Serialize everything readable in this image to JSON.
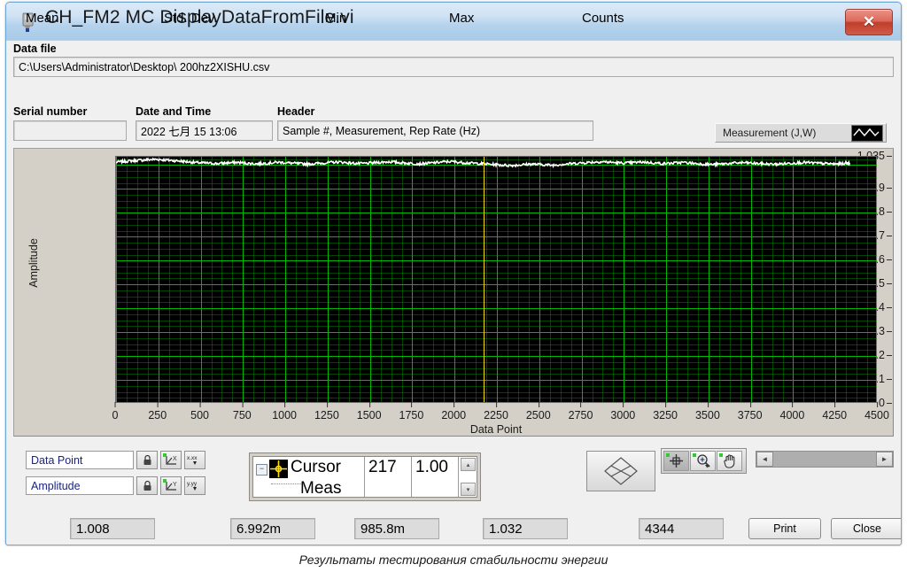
{
  "window": {
    "title": "CH_FM2 MC DisplayDataFromFile.vi",
    "icon": "labview-vi-icon",
    "close_label": "✕",
    "close_icon": "close-icon"
  },
  "datafile": {
    "label": "Data file",
    "value": "C:\\Users\\Administrator\\Desktop\\ 200hz2XISHU.csv"
  },
  "fields": {
    "serial_label": "Serial number",
    "serial_value": "",
    "datetime_label": "Date and Time",
    "datetime_value": "2022 七月 15 13:06",
    "header_label": "Header",
    "header_value": "Sample #, Measurement, Rep Rate (Hz)"
  },
  "legend": {
    "plot_name": "Measurement (J,W)",
    "swatch_icon": "waveform-icon",
    "trace_color": "#ffffff"
  },
  "graph": {
    "xlabel": "Data Point",
    "ylabel": "Amplitude",
    "cursor_line_color": "#f3e000",
    "grid_color": "#00a000",
    "background": "#000000"
  },
  "chart_data": {
    "type": "line",
    "title": "",
    "xlabel": "Data Point",
    "ylabel": "Amplitude",
    "xlim": [
      0,
      4500
    ],
    "ylim": [
      0,
      1.035
    ],
    "grid": true,
    "legend_position": "top-right",
    "xticks": [
      0,
      250,
      500,
      750,
      1000,
      1250,
      1500,
      1750,
      2000,
      2250,
      2500,
      2750,
      3000,
      3250,
      3500,
      3750,
      4000,
      4250,
      4500
    ],
    "yticks": [
      0,
      0.1,
      0.2,
      0.3,
      0.4,
      0.5,
      0.6,
      0.7,
      0.8,
      0.9,
      1.035
    ],
    "ytick_labels": [
      "0",
      "0.1",
      "0.2",
      "0.3",
      "0.4",
      "0.5",
      "0.6",
      "0.7",
      "0.8",
      "0.9",
      "1.035"
    ],
    "cursor_x": 2173,
    "cursor_y": 1.0,
    "series": [
      {
        "name": "Measurement (J,W)",
        "color": "#ffffff",
        "x": [
          0,
          60,
          120,
          180,
          240,
          300,
          360,
          420,
          480,
          540,
          600,
          660,
          720,
          780,
          840,
          900,
          960,
          1020,
          1080,
          1140,
          1200,
          1260,
          1320,
          1380,
          1440,
          1500,
          1560,
          1620,
          1680,
          1740,
          1800,
          1860,
          1920,
          1980,
          2040,
          2100,
          2160,
          2220,
          2280,
          2340,
          2400,
          2460,
          2520,
          2580,
          2640,
          2700,
          2760,
          2820,
          2880,
          2940,
          3000,
          3060,
          3120,
          3180,
          3240,
          3300,
          3360,
          3420,
          3480,
          3540,
          3600,
          3660,
          3720,
          3780,
          3840,
          3900,
          3960,
          4020,
          4080,
          4140,
          4200,
          4260,
          4320,
          4344
        ],
        "values": [
          1.012,
          1.016,
          1.019,
          1.022,
          1.024,
          1.021,
          1.018,
          1.014,
          1.01,
          1.008,
          1.006,
          1.009,
          1.011,
          1.007,
          1.005,
          1.008,
          1.012,
          1.009,
          1.006,
          1.004,
          1.007,
          1.01,
          1.013,
          1.009,
          1.006,
          1.008,
          1.011,
          1.014,
          1.01,
          1.007,
          1.005,
          1.008,
          1.012,
          1.015,
          1.011,
          1.008,
          1.006,
          1.003,
          1.0,
          0.998,
          1.001,
          1.004,
          1.002,
          0.999,
          1.003,
          1.006,
          1.009,
          1.012,
          1.014,
          1.011,
          1.008,
          1.01,
          1.013,
          1.009,
          1.006,
          1.008,
          1.011,
          1.007,
          1.004,
          1.002,
          1.005,
          1.008,
          1.01,
          1.007,
          1.005,
          1.003,
          1.006,
          1.009,
          1.011,
          1.008,
          1.006,
          1.004,
          1.007,
          1.009
        ]
      }
    ]
  },
  "scale_controls": [
    {
      "name": "Data Point",
      "lock_icon": "lock-icon",
      "autoscale_icon": "autoscale-x-icon",
      "format_icon": "format-x-icon",
      "lock_label": "⚿",
      "autoscale_label": "X",
      "format_label": "x.xx"
    },
    {
      "name": "Amplitude",
      "lock_icon": "lock-icon",
      "autoscale_icon": "autoscale-y-icon",
      "format_icon": "format-y-icon",
      "lock_label": "⚿",
      "autoscale_label": "Y",
      "format_label": "y.yy"
    }
  ],
  "cursor_legend": {
    "expand_label": "−",
    "cursor_icon": "cursor-crosshair-icon",
    "row1_name": "Cursor",
    "row2_name": "Meas",
    "row1_x": "217 ",
    "row1_y": "1.00",
    "spin_up": "▴",
    "spin_down": "▾"
  },
  "tools": {
    "cursor_pad_icon": "cursor-move-pad-icon",
    "crosshair_icon": "crosshair-tool-icon",
    "zoom_icon": "zoom-tool-icon",
    "pan_icon": "pan-hand-icon",
    "scroll_left_icon": "scroll-left-arrow-icon",
    "scroll_right_icon": "scroll-right-arrow-icon",
    "scroll_left_label": "◄",
    "scroll_right_label": "►"
  },
  "stats": {
    "mean_label": "Mean",
    "mean_value": "1.008",
    "stddev_label": "Std. Dev.",
    "stddev_value": "6.992m",
    "min_label": "Min",
    "min_value": "985.8m",
    "max_label": "Max",
    "max_value": "1.032",
    "counts_label": "Counts",
    "counts_value": "4344",
    "print_label": "Print",
    "close_label": "Close"
  },
  "caption": "Результаты тестирования стабильности энергии"
}
